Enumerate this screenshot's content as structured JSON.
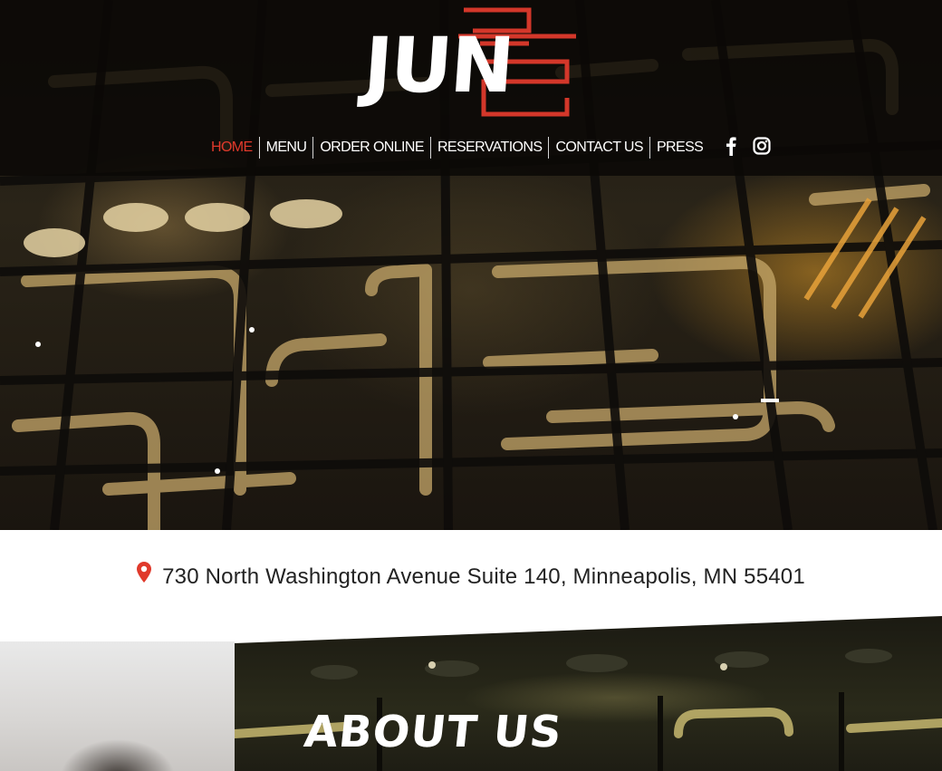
{
  "brand": {
    "logo_text": "JUN",
    "accent_color": "#e0392b"
  },
  "nav": {
    "items": [
      {
        "label": "HOME",
        "active": true
      },
      {
        "label": "MENU",
        "active": false
      },
      {
        "label": "ORDER ONLINE",
        "active": false
      },
      {
        "label": "RESERVATIONS",
        "active": false
      },
      {
        "label": "CONTACT US",
        "active": false
      },
      {
        "label": "PRESS",
        "active": false
      }
    ],
    "social": [
      "facebook-icon",
      "instagram-icon"
    ]
  },
  "address": {
    "icon": "map-pin-icon",
    "text": "730 North Washington Avenue Suite 140, Minneapolis, MN 55401"
  },
  "about": {
    "title": "ABOUT US"
  }
}
